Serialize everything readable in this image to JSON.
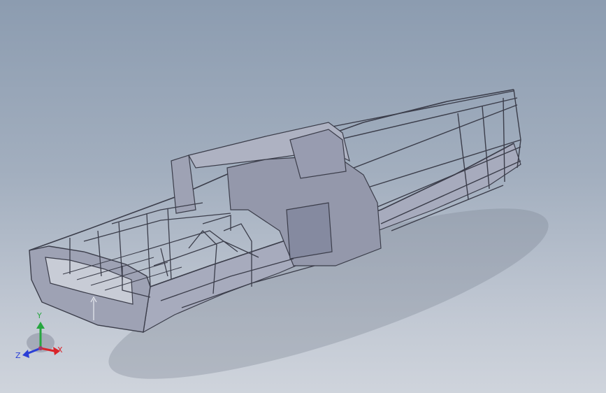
{
  "viewport": {
    "background_top": "#8c9cb0",
    "background_bottom": "#cfd4dc"
  },
  "model": {
    "hull_color": "#9ea2b4",
    "hull_dark": "#7d8196",
    "frame_line": "#3b3d4a"
  },
  "triad": {
    "x_label": "X",
    "y_label": "Y",
    "z_label": "Z",
    "x_color": "#d9242a",
    "y_color": "#27a640",
    "z_color": "#2b3fd6"
  }
}
